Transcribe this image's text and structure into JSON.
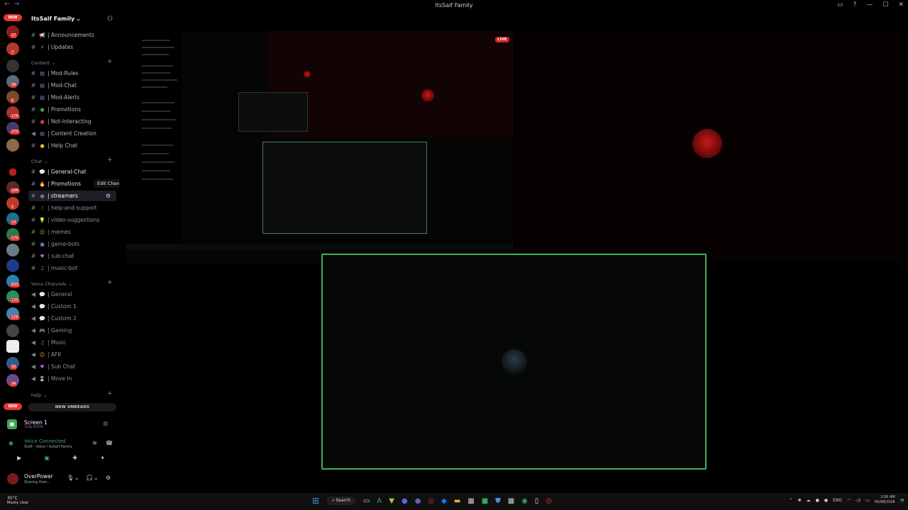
{
  "window": {
    "title": "ItsSaif Family",
    "controls": [
      "▭",
      "?",
      "—",
      "☐",
      "✕"
    ]
  },
  "server": {
    "name": "ItsSaif Family",
    "header_icon": "add-member-icon"
  },
  "rail": {
    "new_label": "NEW",
    "badges": [
      "27",
      "7",
      "38",
      "6",
      "176",
      "270",
      "168",
      "1",
      "13",
      "170",
      "833",
      "120",
      "126",
      "50",
      "34"
    ]
  },
  "channels_top": [
    {
      "icon": "📢",
      "label": "| Announcements"
    },
    {
      "icon": "⚡",
      "label": "| Updates"
    }
  ],
  "categories": {
    "content": "Content",
    "chat": "Chat",
    "voice": "Voice Channels",
    "help": "help"
  },
  "content_channels": [
    {
      "icon": "▤",
      "label": "| Mod-Rules"
    },
    {
      "icon": "▤",
      "label": "| Mod-Chat"
    },
    {
      "icon": "▤",
      "label": "| Mod-Alerts"
    },
    {
      "icon": "●",
      "label": "| Promotions"
    },
    {
      "icon": "●",
      "label": "| Not-Interacting"
    },
    {
      "icon": "▤",
      "label": "| Content Creation"
    },
    {
      "icon": "●",
      "label": "| Help Chat"
    }
  ],
  "chat_channels": [
    {
      "icon": "💬",
      "label": "| General-Chat"
    },
    {
      "icon": "🔥",
      "label": "| Promotions"
    },
    {
      "icon": "●",
      "label": "| streamers"
    },
    {
      "icon": "?",
      "label": "| help-and-support"
    },
    {
      "icon": "💡",
      "label": "| video-suggestions"
    },
    {
      "icon": "☺",
      "label": "| memes"
    },
    {
      "icon": "▣",
      "label": "| game-bots"
    },
    {
      "icon": "♥",
      "label": "| sub-chat"
    },
    {
      "icon": "♫",
      "label": "| music-bot"
    }
  ],
  "voice_channels": [
    {
      "icon": "💬",
      "label": "| General"
    },
    {
      "icon": "💬",
      "label": "| Custom 1"
    },
    {
      "icon": "💬",
      "label": "| Custom 2"
    },
    {
      "icon": "🎮",
      "label": "| Gaming"
    },
    {
      "icon": "♫",
      "label": "| Music"
    },
    {
      "icon": "☺",
      "label": "| AFK"
    },
    {
      "icon": "♥",
      "label": "| Sub Chat"
    },
    {
      "icon": "⌛",
      "label": "| Move In"
    }
  ],
  "tooltip": "Edit Channel",
  "new_unreads": "NEW UNREADS",
  "stream": {
    "title": "Screen 1",
    "subtitle": "720p 60FPS"
  },
  "voice": {
    "title": "Voice Connected",
    "subtitle": "Staff - Voice / ItsSaif Family"
  },
  "user": {
    "name": "OverPower",
    "status": "Sharing their..."
  },
  "live_badge": "LIVE",
  "taskbar": {
    "temp": "35°C",
    "weather": "Mostly clear",
    "search": "Search",
    "lang": "ENG",
    "time": "2:00 AM",
    "date": "05/08/2026"
  }
}
